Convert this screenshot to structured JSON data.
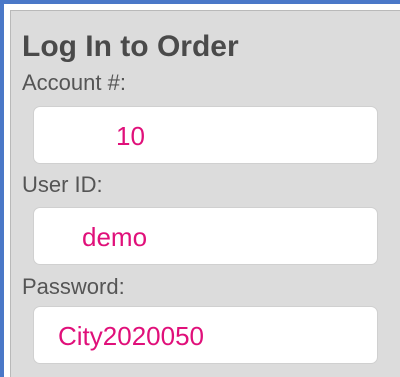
{
  "login": {
    "title": "Log In to Order",
    "account_label": "Account #:",
    "account_value": "10",
    "user_label": "User ID:",
    "user_value": "demo",
    "password_label": "Password:",
    "password_value": "City2020050"
  },
  "colors": {
    "panel_background": "#dcdcdc",
    "field_text": "#e0107a",
    "label_text": "#555555",
    "window_accent": "#4a78c8"
  }
}
